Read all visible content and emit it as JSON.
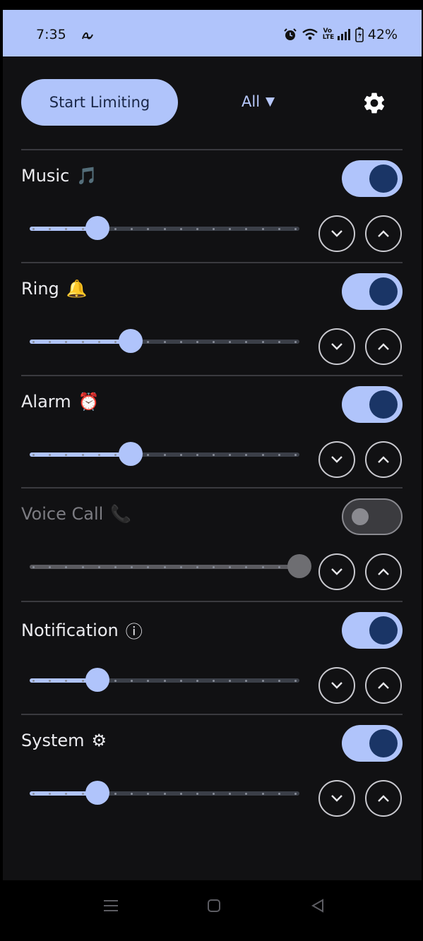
{
  "status_bar": {
    "time": "7:35",
    "battery": "42%",
    "network_label": "Vo\nLTE",
    "icons": [
      "notification-icon",
      "alarm-icon",
      "wifi-icon",
      "volte-icon",
      "signal-icon",
      "battery-icon"
    ]
  },
  "toolbar": {
    "start_label": "Start Limiting",
    "filter_label": "All",
    "filter_caret": "▼"
  },
  "sections": [
    {
      "title": "Music",
      "emoji": "🎵",
      "enabled": true,
      "level": 0.25
    },
    {
      "title": "Ring",
      "emoji": "🔔",
      "enabled": true,
      "level": 0.375
    },
    {
      "title": "Alarm",
      "emoji": "⏰",
      "enabled": true,
      "level": 0.375
    },
    {
      "title": "Voice Call",
      "emoji": "📞",
      "enabled": false,
      "level": 1.0
    },
    {
      "title": "Notification",
      "emoji": "ⓘ",
      "enabled": true,
      "level": 0.25
    },
    {
      "title": "System",
      "emoji": "⚙",
      "enabled": true,
      "level": 0.25
    }
  ],
  "colors": {
    "accent": "#b0c4fb",
    "knob": "#1a3566",
    "background": "#111113"
  }
}
